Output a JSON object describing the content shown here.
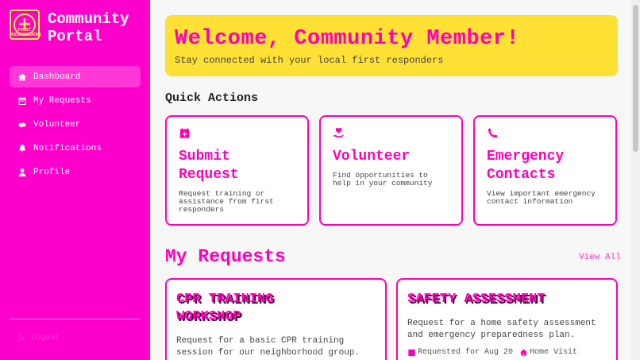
{
  "brand": {
    "line1": "Community",
    "line2": "Portal",
    "logo_symbol": "+",
    "logo_text": "FIRST RESPONDERS"
  },
  "nav": [
    {
      "label": "Dashboard",
      "icon": "home-icon",
      "active": true
    },
    {
      "label": "My Requests",
      "icon": "calendar-icon",
      "active": false
    },
    {
      "label": "Volunteer",
      "icon": "handshake-icon",
      "active": false
    },
    {
      "label": "Notifications",
      "icon": "bell-icon",
      "active": false
    },
    {
      "label": "Profile",
      "icon": "user-icon",
      "active": false
    }
  ],
  "logout_label": "Logout",
  "welcome": {
    "title": "Welcome, Community Member!",
    "subtitle": "Stay connected with your local first responders"
  },
  "quick_actions": {
    "title": "Quick Actions",
    "cards": [
      {
        "title_line1": "Submit",
        "title_line2": "Request",
        "desc": "Request training or assistance from first responders",
        "icon": "calendar-plus-icon"
      },
      {
        "title_line1": "Volunteer",
        "title_line2": "",
        "desc": "Find opportunities to help in your community",
        "icon": "hand-heart-icon"
      },
      {
        "title_line1": "Emergency",
        "title_line2": "Contacts",
        "desc": "View important emergency contact information",
        "icon": "phone-icon"
      }
    ]
  },
  "requests": {
    "title": "My Requests",
    "view_all": "View All",
    "cards": [
      {
        "title_line1": "CPR TRAINING",
        "title_line2": "WORKSHOP",
        "desc": "Request for a basic CPR training session for our neighborhood group."
      },
      {
        "title_line1": "SAFETY ASSESSMENT",
        "title_line2": "",
        "desc": "Request for a home safety assessment and emergency preparedness plan.",
        "date": "Requested for Aug 20",
        "type": "Home Visit"
      }
    ]
  },
  "colors": {
    "sidebar": "#ff00cc",
    "accent": "#ff00b8",
    "banner": "#ffe135"
  }
}
